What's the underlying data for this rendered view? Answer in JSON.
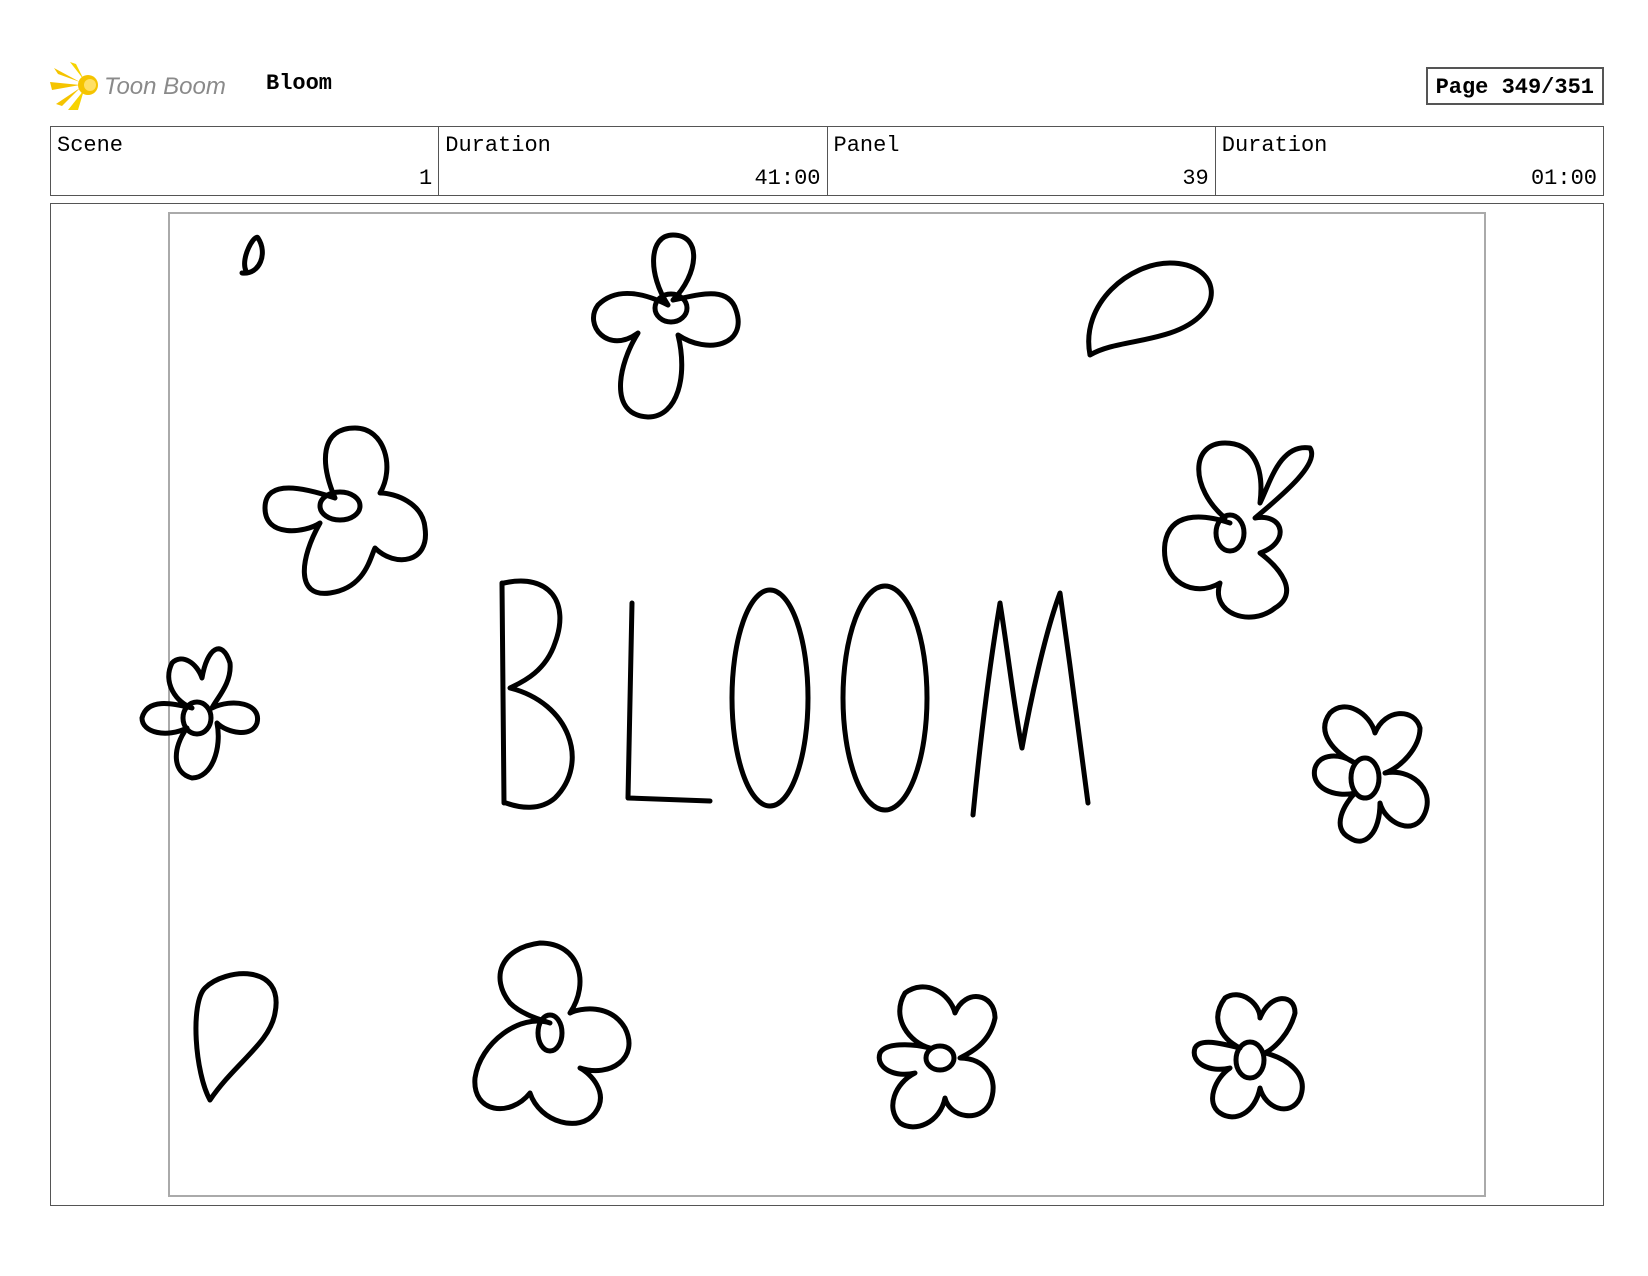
{
  "header": {
    "logo_text": "Toon Boom",
    "project_title": "Bloom",
    "page_indicator": "Page 349/351"
  },
  "info_table": [
    {
      "label": "Scene",
      "value": "1"
    },
    {
      "label": "Duration",
      "value": "41:00"
    },
    {
      "label": "Panel",
      "value": "39"
    },
    {
      "label": "Duration",
      "value": "01:00"
    }
  ],
  "panel": {
    "drawing_text": "BLOOM",
    "description": ""
  },
  "colors": {
    "logo_yellow": "#f5c400",
    "logo_grey": "#8a8a8a",
    "border": "#555555",
    "camera_frame": "#aaaaaa"
  }
}
